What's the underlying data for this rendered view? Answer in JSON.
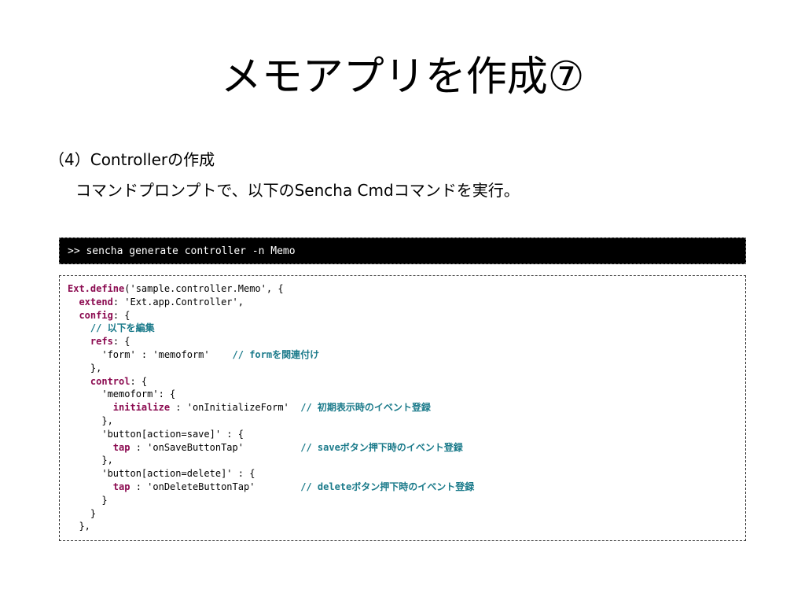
{
  "slide": {
    "title": "メモアプリを作成⑦",
    "subheading": "（4）Controllerの作成",
    "instruction": "コマンドプロンプトで、以下のSencha Cmdコマンドを実行。"
  },
  "command": {
    "text": ">> sencha generate controller -n Memo"
  },
  "colors": {
    "keyword": "#8b0a50",
    "comment": "#1a7a8a",
    "command_background": "#000000"
  },
  "code": {
    "lines": [
      [
        {
          "t": "Ext.define",
          "k": "kw"
        },
        {
          "t": "('sample.controller.Memo', {",
          "k": "pl"
        }
      ],
      [
        {
          "t": "  ",
          "k": "pl"
        },
        {
          "t": "extend",
          "k": "kw"
        },
        {
          "t": ": 'Ext.app.Controller',",
          "k": "pl"
        }
      ],
      [
        {
          "t": "  ",
          "k": "pl"
        },
        {
          "t": "config",
          "k": "kw"
        },
        {
          "t": ": {",
          "k": "pl"
        }
      ],
      [
        {
          "t": "    ",
          "k": "pl"
        },
        {
          "t": "// 以下を編集",
          "k": "cm"
        }
      ],
      [
        {
          "t": "    ",
          "k": "pl"
        },
        {
          "t": "refs",
          "k": "kw"
        },
        {
          "t": ": {",
          "k": "pl"
        }
      ],
      [
        {
          "t": "      'form' : 'memoform'    ",
          "k": "pl"
        },
        {
          "t": "// formを関連付け",
          "k": "cm"
        }
      ],
      [
        {
          "t": "    },",
          "k": "pl"
        }
      ],
      [
        {
          "t": "    ",
          "k": "pl"
        },
        {
          "t": "control",
          "k": "kw"
        },
        {
          "t": ": {",
          "k": "pl"
        }
      ],
      [
        {
          "t": "      'memoform': {",
          "k": "pl"
        }
      ],
      [
        {
          "t": "        ",
          "k": "pl"
        },
        {
          "t": "initialize",
          "k": "kw"
        },
        {
          "t": " : 'onInitializeForm'  ",
          "k": "pl"
        },
        {
          "t": "// 初期表示時のイベント登録",
          "k": "cm"
        }
      ],
      [
        {
          "t": "      },",
          "k": "pl"
        }
      ],
      [
        {
          "t": "      'button[action=save]' : {",
          "k": "pl"
        }
      ],
      [
        {
          "t": "        ",
          "k": "pl"
        },
        {
          "t": "tap",
          "k": "kw"
        },
        {
          "t": " : 'onSaveButtonTap'          ",
          "k": "pl"
        },
        {
          "t": "// saveボタン押下時のイベント登録",
          "k": "cm"
        }
      ],
      [
        {
          "t": "      },",
          "k": "pl"
        }
      ],
      [
        {
          "t": "      'button[action=delete]' : {",
          "k": "pl"
        }
      ],
      [
        {
          "t": "        ",
          "k": "pl"
        },
        {
          "t": "tap",
          "k": "kw"
        },
        {
          "t": " : 'onDeleteButtonTap'        ",
          "k": "pl"
        },
        {
          "t": "// deleteボタン押下時のイベント登録",
          "k": "cm"
        }
      ],
      [
        {
          "t": "      }",
          "k": "pl"
        }
      ],
      [
        {
          "t": "    }",
          "k": "pl"
        }
      ],
      [
        {
          "t": "  },",
          "k": "pl"
        }
      ]
    ]
  }
}
